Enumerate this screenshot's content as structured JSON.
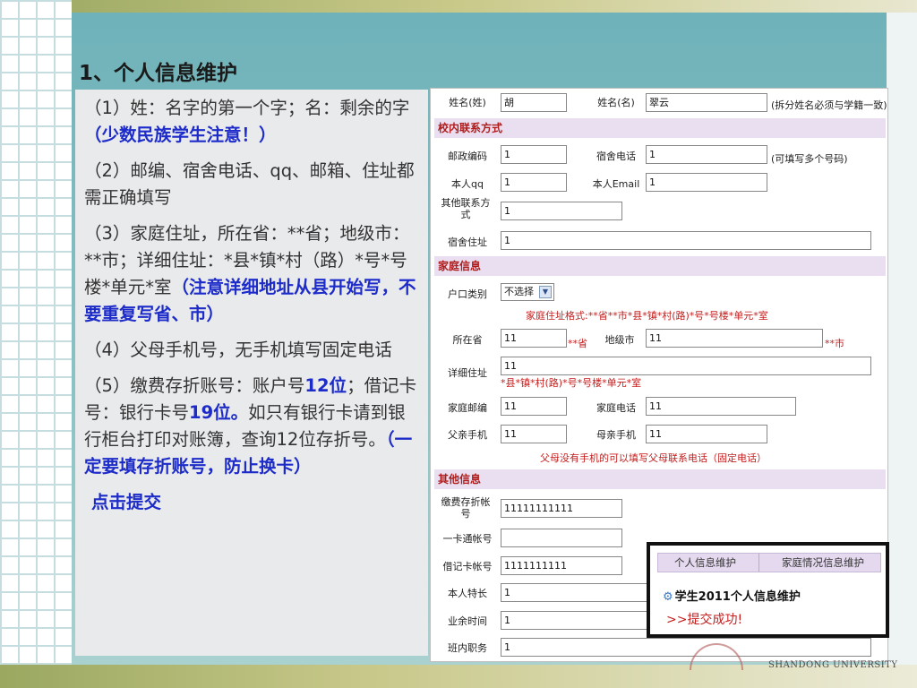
{
  "title": "1、个人信息维护",
  "instructions": {
    "p1": "（1）姓：名字的第一个字；名：剩余的字",
    "p1_hl": "（少数民族学生注意！）",
    "p2": "（2）邮编、宿舍电话、qq、邮箱、住址都需正确填写",
    "p3": "（3）家庭住址，所在省：**省；地级市：**市；详细住址：*县*镇*村（路）*号*号楼*单元*室",
    "p3_hl": "（注意详细地址从县开始写，不要重复写省、市）",
    "p4": "（4）父母手机号，无手机填写固定电话",
    "p5_a": "（5）缴费存折账号：账户号",
    "p5_b": "12位",
    "p5_c": "；借记卡号：银行卡号",
    "p5_d": "19位。",
    "p5_e": "如只有银行卡请到银行柜台打印对账簿，查询12位存折号。",
    "p5_hl": "（一定要填存折账号，防止换卡）",
    "submit": "点击提交"
  },
  "form": {
    "surname_label": "姓名(姓)",
    "surname_value": "胡",
    "given_label": "姓名(名)",
    "given_value": "翠云",
    "name_note": "(拆分姓名必须与学籍一致)",
    "section_contact": "校内联系方式",
    "postcode_label": "邮政编码",
    "postcode_value": "1",
    "dorm_phone_label": "宿舍电话",
    "dorm_phone_value": "1",
    "dorm_phone_note": "(可填写多个号码)",
    "qq_label": "本人qq",
    "qq_value": "1",
    "email_label": "本人Email",
    "email_value": "1",
    "other_contact_label": "其他联系方式",
    "other_contact_value": "1",
    "dorm_addr_label": "宿舍住址",
    "dorm_addr_value": "1",
    "section_family": "家庭信息",
    "hukou_label": "户口类别",
    "hukou_value": "不选择",
    "family_addr_format": "家庭住址格式:**省**市*县*镇*村(路)*号*号楼*单元*室",
    "province_label": "所在省",
    "province_value": "11",
    "province_suffix": "**省",
    "city_label": "地级市",
    "city_value": "11",
    "city_suffix": "**市",
    "detail_addr_label": "详细住址",
    "detail_addr_value": "11",
    "detail_addr_hint": "*县*镇*村(路)*号*号楼*单元*室",
    "family_postcode_label": "家庭邮编",
    "family_postcode_value": "11",
    "family_phone_label": "家庭电话",
    "family_phone_value": "11",
    "father_label": "父亲手机",
    "father_value": "11",
    "mother_label": "母亲手机",
    "mother_value": "11",
    "parent_note": "父母没有手机的可以填写父母联系电话（固定电话）",
    "section_other": "其他信息",
    "passbook_label": "缴费存折帐号",
    "passbook_value": "11111111111",
    "card_label": "一卡通帐号",
    "card_value": "",
    "debit_label": "借记卡帐号",
    "debit_value": "1111111111",
    "specialty_label": "本人特长",
    "specialty_value": "1",
    "hobby_label": "业余时间",
    "hobby_value": "1",
    "class_duty_label": "班内职务",
    "class_duty_value": "1"
  },
  "popup": {
    "tab1": "个人信息维护",
    "tab2": "家庭情况信息维护",
    "title": "学生2011个人信息维护",
    "message": ">>提交成功!"
  },
  "logo": {
    "text": "SHANDONG UNIVERSITY"
  }
}
